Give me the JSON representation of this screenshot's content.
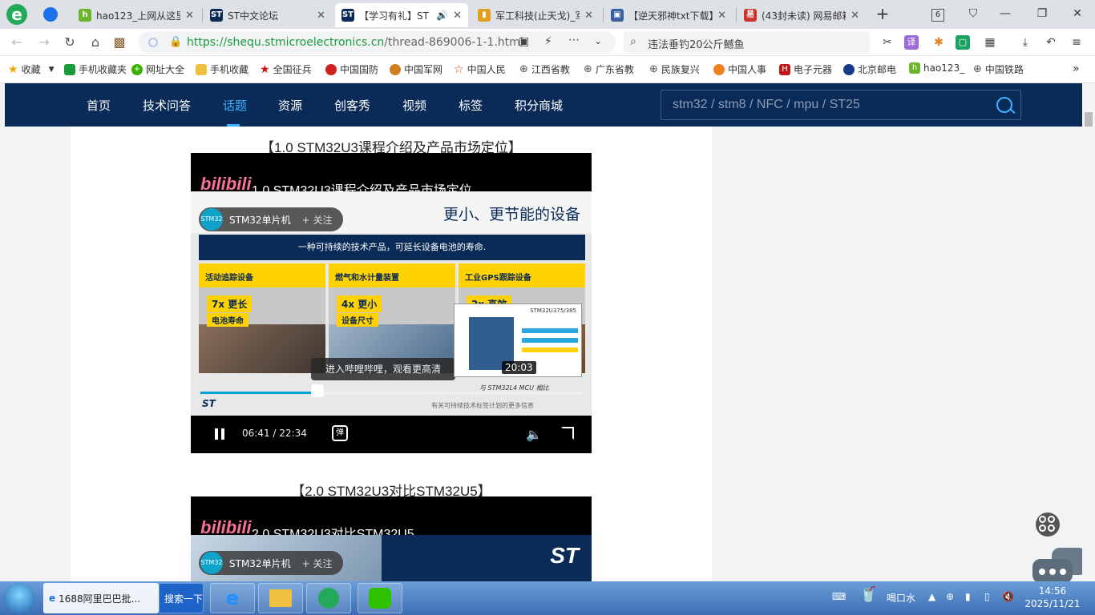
{
  "tabs": [
    {
      "title": "hao123_上网从这里",
      "active": false
    },
    {
      "title": "ST中文论坛",
      "active": false
    },
    {
      "title": "【学习有礼】ST",
      "active": true
    },
    {
      "title": "军工科技(止天戈)_军",
      "active": false
    },
    {
      "title": "【逆天邪神txt下载】",
      "active": false
    },
    {
      "title": "(43封未读) 网易邮箱",
      "active": false
    }
  ],
  "tab_count": "6",
  "address": {
    "scheme": "https://",
    "host": "shequ.stmicroelectronics.cn",
    "path": "/thread-869006-1-1.html"
  },
  "search_query": "违法垂钓20公斤鳡鱼",
  "bookmarks": [
    "收藏",
    "手机收藏夹",
    "网址大全",
    "手机收藏",
    "全国征兵",
    "中国国防",
    "中国军网",
    "中国人民",
    "江西省教",
    "广东省教",
    "民族复兴",
    "中国人事",
    "电子元器",
    "北京邮电",
    "hao123_",
    "中国铁路"
  ],
  "site_nav": {
    "items": [
      "首页",
      "技术问答",
      "话题",
      "资源",
      "创客秀",
      "视频",
      "标签",
      "积分商城"
    ],
    "active_index": 2,
    "search_placeholder": "stm32 / stm8 / NFC / mpu / ST25"
  },
  "video1": {
    "heading": "【1.0 STM32U3课程介绍及产品市场定位】",
    "brand": "bilibili",
    "title": "1.0 STM32U3课程介绍及产品市场定位",
    "channel": "STM32单片机",
    "follow": "+ 关注",
    "slide_title": "更小、更节能的设备",
    "banner": "一种可持续的技术产品，可延长设备电池的寿命.",
    "panels": [
      {
        "head": "活动追踪设备",
        "stat": "7x 更长",
        "sub": "电池寿命"
      },
      {
        "head": "燃气和水计量装置",
        "stat": "4x 更小",
        "sub": "设备尺寸"
      },
      {
        "head": "工业GPS跟踪设备",
        "stat": "2x 高效",
        "sub": ""
      }
    ],
    "hint": "进入哔哩哔哩，观看更高清",
    "preview_title": "STM32U375/385",
    "preview_time": "20:03",
    "progress": 0.3,
    "foot_logo": "ST",
    "foot_text": "有关可持续技术标签计划的更多信息",
    "foot_text2": "与 STM32L4 MCU 相比",
    "time_current": "06:41",
    "time_sep": "/",
    "time_total": "22:34",
    "danmaku": "弹"
  },
  "video2": {
    "heading": "【2.0 STM32U3对比STM32U5】",
    "brand": "bilibili",
    "title": "2.0 STM32U3对比STM32U5",
    "channel": "STM32单片机",
    "follow": "+ 关注",
    "logo": "ST"
  },
  "taskbar": {
    "items": [
      "1688阿里巴巴批...",
      "搜索一下"
    ],
    "tray_text": "喝口水",
    "time": "14:56",
    "date": "2025/11/21"
  },
  "colors": {
    "nav_bg": "#0a2b57",
    "nav_active": "#3cb1ff",
    "bili_pink": "#fb7299",
    "st_yellow": "#ffd200"
  }
}
